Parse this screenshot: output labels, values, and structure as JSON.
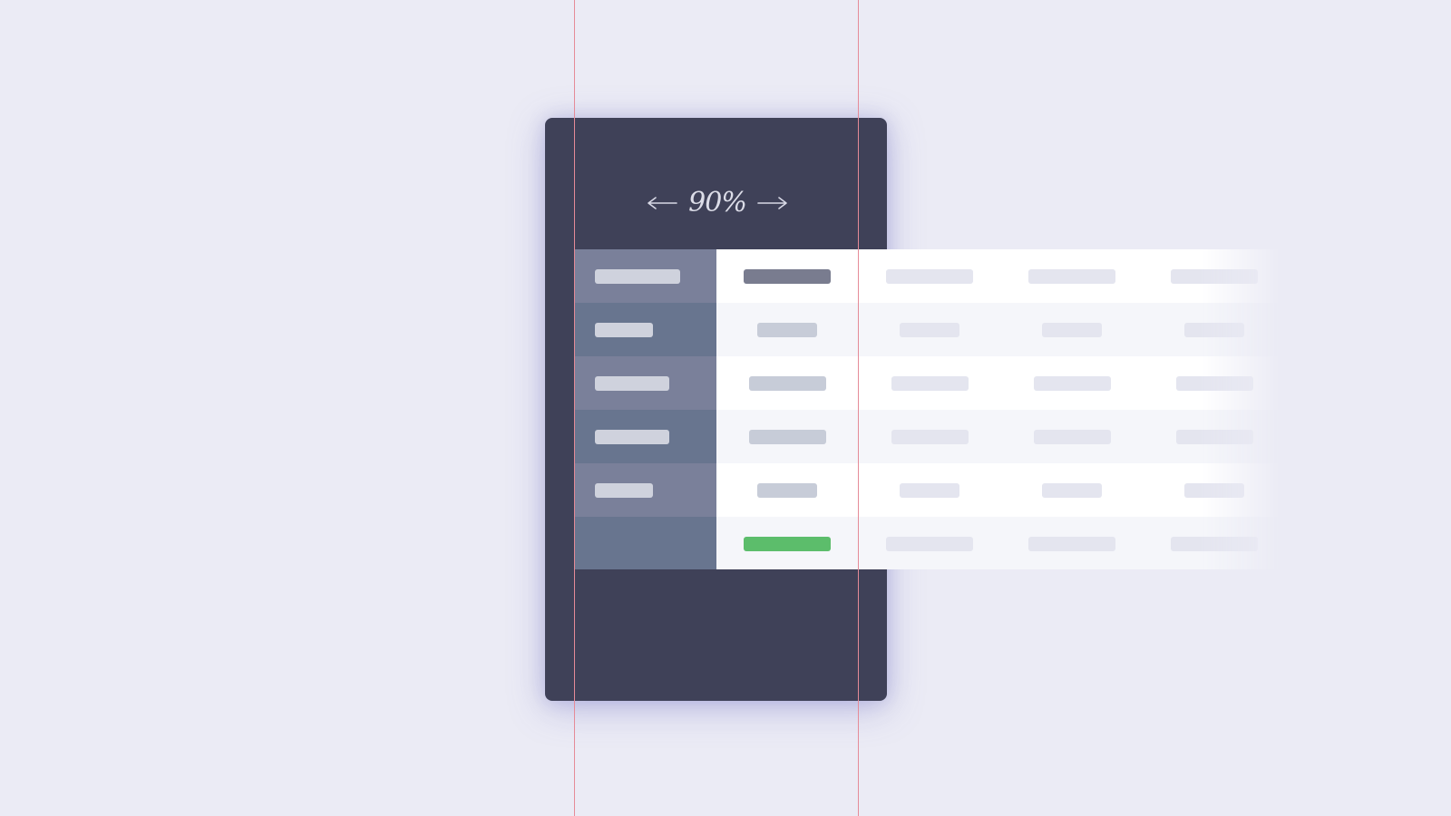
{
  "zoom": {
    "value": "90%",
    "left_arrow_icon": "arrow-left-icon",
    "right_arrow_icon": "arrow-right-icon"
  },
  "colors": {
    "background": "#ebebf5",
    "phone": "#3f4158",
    "header_light": "#7a809a",
    "header_dark": "#68758f",
    "highlight_pill": "#797c8f",
    "success_pill": "#5cbd6b",
    "guide_line": "#e58b98"
  },
  "table": {
    "rows": 6,
    "visible_columns": 5,
    "highlighted_row": 1,
    "success_row": 6
  }
}
